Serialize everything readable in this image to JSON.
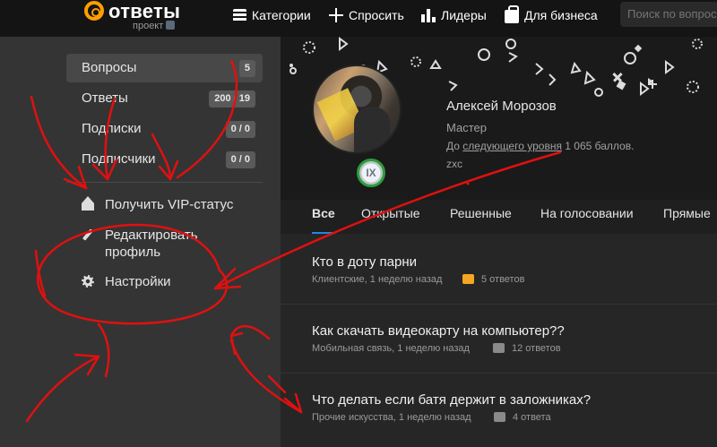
{
  "header": {
    "logo_text": "ответы",
    "logo_sub": "проект",
    "nav": [
      {
        "label": "Категории",
        "icon": "list-icon"
      },
      {
        "label": "Спросить",
        "icon": "plus-icon"
      },
      {
        "label": "Лидеры",
        "icon": "leaderboard-icon"
      },
      {
        "label": "Для бизнеса",
        "icon": "briefcase-icon"
      }
    ],
    "search_placeholder": "Поиск по вопросам"
  },
  "sidebar": {
    "items": [
      {
        "label": "Вопросы",
        "count": "5",
        "active": true
      },
      {
        "label": "Ответы",
        "count": "200 / 19",
        "active": false
      },
      {
        "label": "Подписки",
        "count": "0 / 0",
        "active": false
      },
      {
        "label": "Подписчики",
        "count": "0 / 0",
        "active": false
      }
    ],
    "links": [
      {
        "label": "Получить VIP-статус",
        "icon": "crown-icon"
      },
      {
        "label": "Редактировать профиль",
        "icon": "pencil-icon"
      },
      {
        "label": "Настройки",
        "icon": "gear-icon"
      }
    ]
  },
  "profile": {
    "name": "Алексей Морозов",
    "rank": "Мастер",
    "level_prefix": "До ",
    "level_link": "следующего уровня",
    "level_suffix": " 1 065 баллов.",
    "status": "zxc",
    "level_badge": "IX"
  },
  "tabs": [
    {
      "label": "Все",
      "active": true
    },
    {
      "label": "Открытые",
      "active": false
    },
    {
      "label": "Решенные",
      "active": false
    },
    {
      "label": "На голосовании",
      "active": false
    },
    {
      "label": "Прямые",
      "active": false
    }
  ],
  "questions": [
    {
      "title": "Кто в доту парни",
      "meta": "Клиентские, 1 неделю назад",
      "answers": "5 ответов",
      "bubble_color": "#f5a623"
    },
    {
      "title": "Как скачать видеокарту на компьютер??",
      "meta": "Мобильная связь, 1 неделю назад",
      "answers": "12 ответов",
      "bubble_color": "#8a8a8a"
    },
    {
      "title": "Что делать если батя держит в заложниках?",
      "meta": "Прочие искусства, 1 неделю назад",
      "answers": "4 ответа",
      "bubble_color": "#8a8a8a"
    }
  ],
  "colors": {
    "accent_orange": "#ff9e00",
    "tab_underline": "#1e88e5",
    "annotation_red": "#e01010",
    "level_badge_ring": "#2d9d3a"
  }
}
